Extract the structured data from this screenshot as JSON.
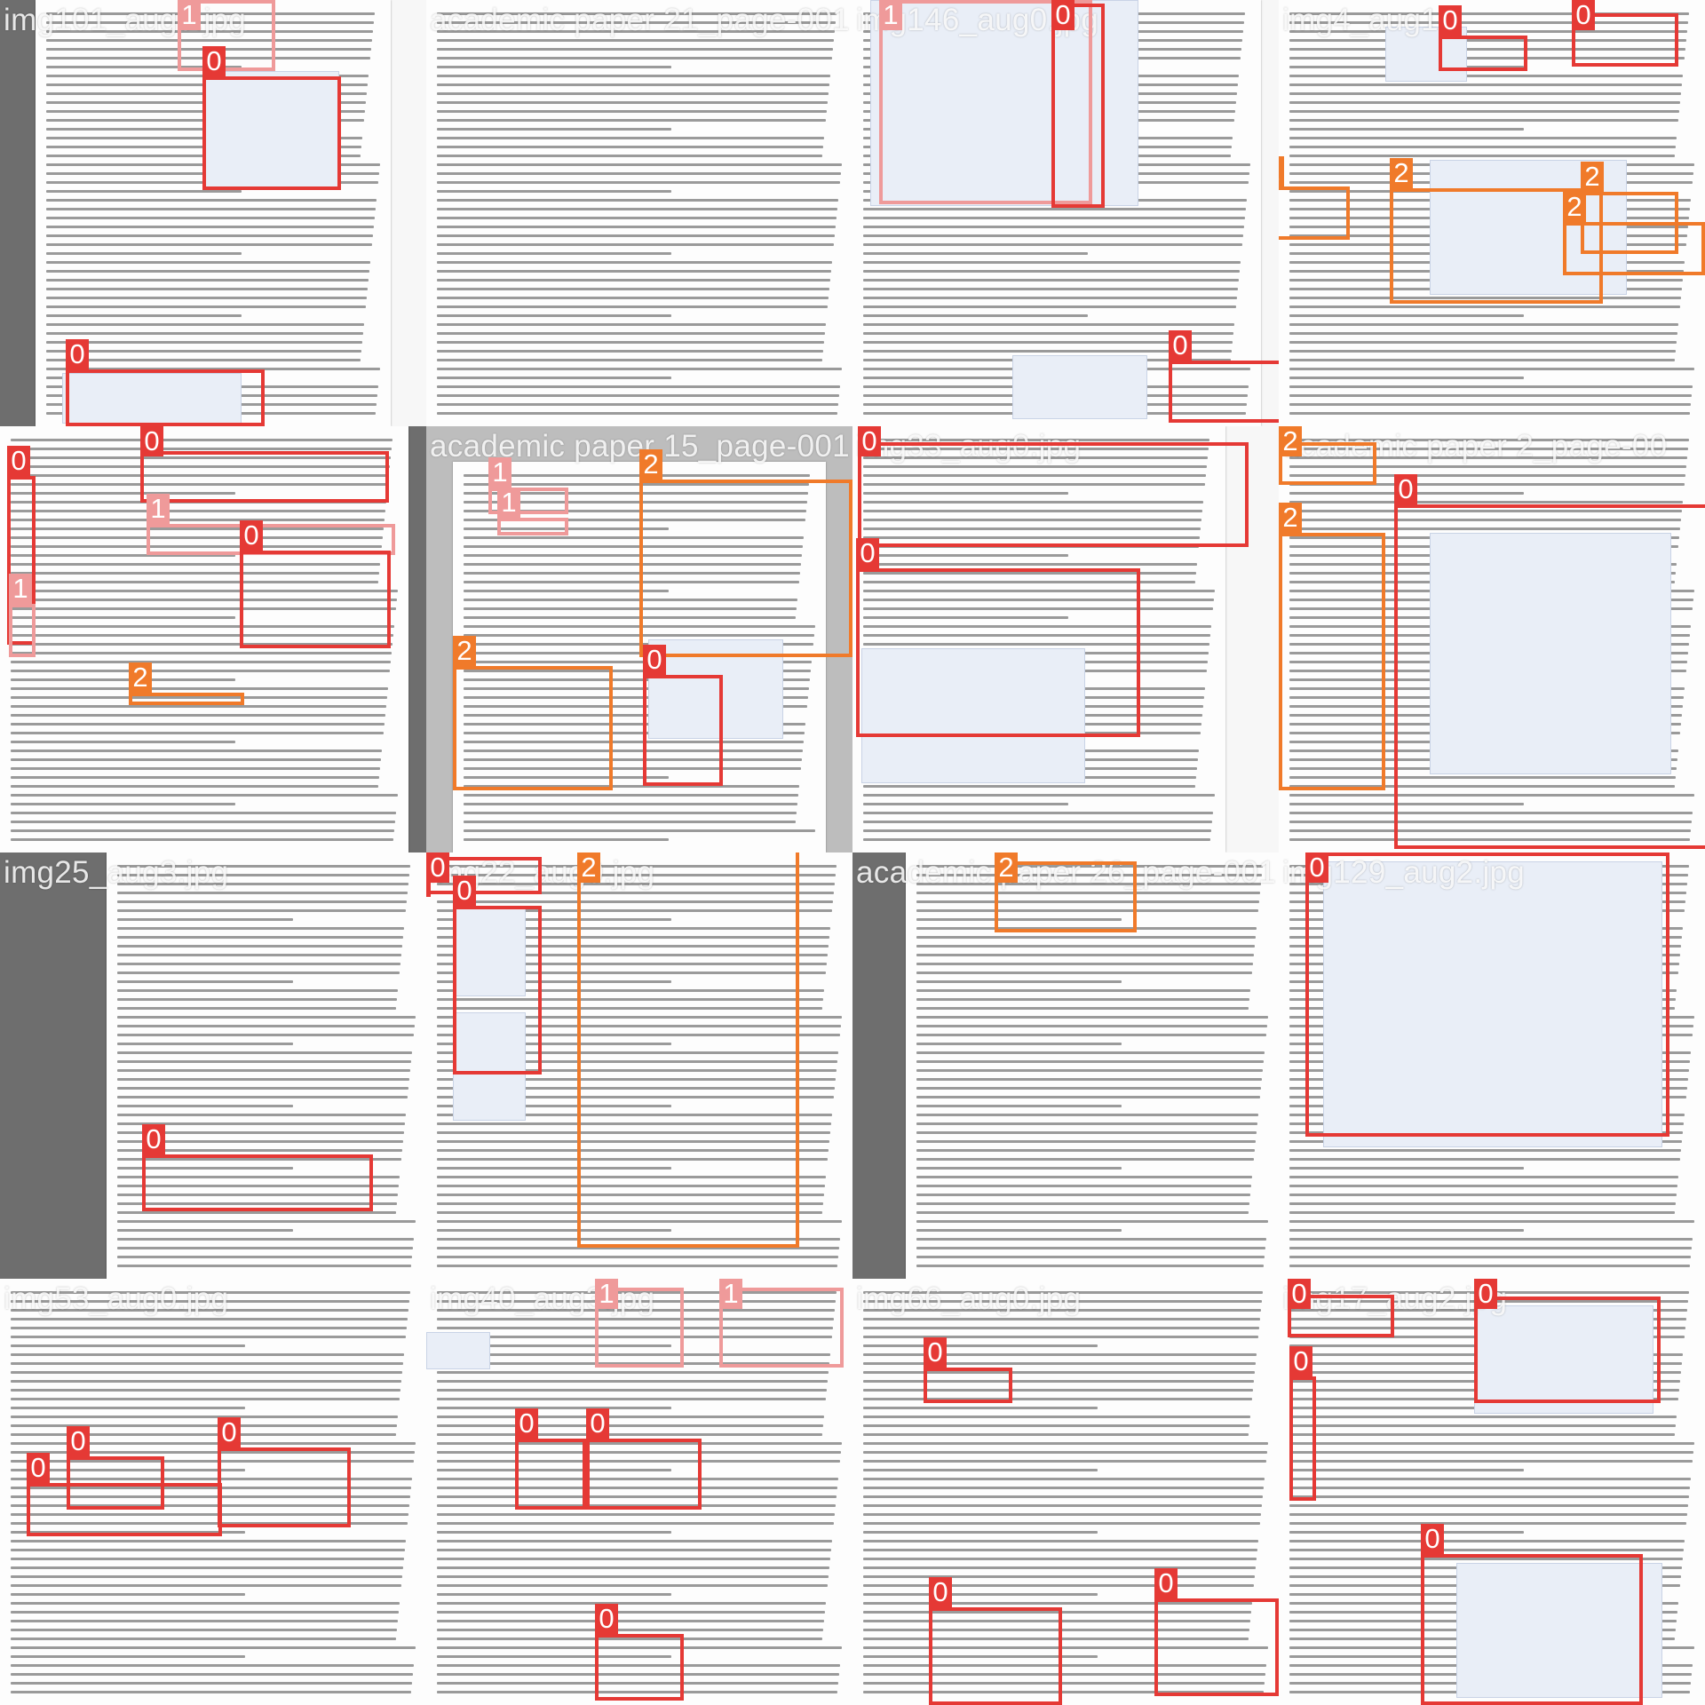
{
  "colors": {
    "class_0": "#e53935",
    "class_1": "#ef9a9a",
    "class_2": "#f07a2a"
  },
  "tiles": [
    {
      "caption": "img101_aug0.jpg",
      "dark": false,
      "boxes": [
        {
          "label": "1",
          "cls": 1
        },
        {
          "label": "0",
          "cls": 0
        },
        {
          "label": "0",
          "cls": 0
        }
      ]
    },
    {
      "caption": "academic paper 21_page-001",
      "dark": true,
      "boxes": []
    },
    {
      "caption": "img146_aug0.jpg",
      "dark": false,
      "boxes": [
        {
          "label": "1",
          "cls": 1
        },
        {
          "label": "0",
          "cls": 0
        },
        {
          "label": "0",
          "cls": 0
        }
      ]
    },
    {
      "caption": "img4_aug1",
      "dark": false,
      "boxes": [
        {
          "label": "0",
          "cls": 0
        },
        {
          "label": "2",
          "cls": 2
        },
        {
          "label": "0",
          "cls": 0
        },
        {
          "label": "2",
          "cls": 2
        },
        {
          "label": "2",
          "cls": 2
        },
        {
          "label": "2",
          "cls": 2
        }
      ]
    },
    {
      "caption": "",
      "dark": true,
      "boxes": [
        {
          "label": "0",
          "cls": 0
        },
        {
          "label": "0",
          "cls": 0
        },
        {
          "label": "1",
          "cls": 1
        },
        {
          "label": "1",
          "cls": 1
        },
        {
          "label": "0",
          "cls": 0
        },
        {
          "label": "2",
          "cls": 2
        }
      ]
    },
    {
      "caption": "academic paper 15_page-001",
      "dark": true,
      "boxes": [
        {
          "label": "1",
          "cls": 1
        },
        {
          "label": "1",
          "cls": 1
        },
        {
          "label": "2",
          "cls": 2
        },
        {
          "label": "2",
          "cls": 2
        },
        {
          "label": "0",
          "cls": 0
        }
      ]
    },
    {
      "caption": "img33_aug0.jpg",
      "dark": false,
      "boxes": [
        {
          "label": "0",
          "cls": 0
        },
        {
          "label": "0",
          "cls": 0
        }
      ]
    },
    {
      "caption": "academic paper 2_page-00",
      "dark": false,
      "boxes": [
        {
          "label": "2",
          "cls": 2
        },
        {
          "label": "2",
          "cls": 2
        },
        {
          "label": "0",
          "cls": 0
        }
      ]
    },
    {
      "caption": "img25_aug3.jpg",
      "dark": false,
      "boxes": [
        {
          "label": "0",
          "cls": 0
        }
      ]
    },
    {
      "caption": "img22_aug0.jpg",
      "dark": false,
      "boxes": [
        {
          "label": "0",
          "cls": 0
        },
        {
          "label": "0",
          "cls": 0
        },
        {
          "label": "0",
          "cls": 0
        },
        {
          "label": "2",
          "cls": 2
        }
      ]
    },
    {
      "caption": "academic paper 26_page-001",
      "dark": false,
      "boxes": [
        {
          "label": "2",
          "cls": 2
        }
      ]
    },
    {
      "caption": "img129_aug2.jpg",
      "dark": false,
      "boxes": [
        {
          "label": "0",
          "cls": 0
        }
      ]
    },
    {
      "caption": "img53_aug0.jpg",
      "dark": false,
      "boxes": [
        {
          "label": "0",
          "cls": 0
        },
        {
          "label": "0",
          "cls": 0
        },
        {
          "label": "0",
          "cls": 0
        }
      ]
    },
    {
      "caption": "img40_aug3.jpg",
      "dark": false,
      "boxes": [
        {
          "label": "1",
          "cls": 1
        },
        {
          "label": "0",
          "cls": 0
        },
        {
          "label": "0",
          "cls": 0
        },
        {
          "label": "1",
          "cls": 1
        },
        {
          "label": "0",
          "cls": 0
        }
      ]
    },
    {
      "caption": "img66_aug0.jpg",
      "dark": false,
      "boxes": [
        {
          "label": "0",
          "cls": 0
        },
        {
          "label": "0",
          "cls": 0
        },
        {
          "label": "0",
          "cls": 0
        }
      ]
    },
    {
      "caption": "img17_aug2.jpg",
      "dark": false,
      "boxes": [
        {
          "label": "0",
          "cls": 0
        },
        {
          "label": "0",
          "cls": 0
        },
        {
          "label": "0",
          "cls": 0
        },
        {
          "label": "0",
          "cls": 0
        }
      ]
    }
  ]
}
